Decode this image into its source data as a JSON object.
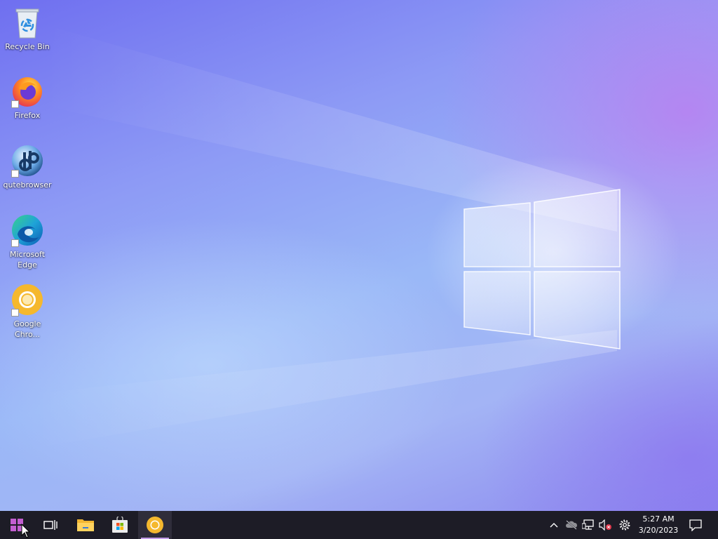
{
  "desktop": {
    "icons": [
      {
        "label": "Recycle Bin",
        "icon": "recycle-bin-icon"
      },
      {
        "label": "Firefox",
        "icon": "firefox-icon"
      },
      {
        "label": "qutebrowser",
        "icon": "qutebrowser-icon"
      },
      {
        "label": "Microsoft Edge",
        "icon": "edge-icon"
      },
      {
        "label": "Google Chro...",
        "icon": "chrome-icon"
      }
    ]
  },
  "taskbar": {
    "start_icon": "windows-start-icon",
    "task_view_icon": "task-view-icon",
    "pinned": [
      {
        "name": "File Explorer",
        "icon": "folder-icon"
      },
      {
        "name": "Microsoft Store",
        "icon": "store-icon"
      },
      {
        "name": "Google Chrome",
        "icon": "chrome-icon",
        "active": true
      }
    ],
    "tray": {
      "icons": [
        "chevron-up-icon",
        "onedrive-offline-icon",
        "network-icon",
        "volume-muted-icon",
        "settings-gear-icon"
      ],
      "time": "5:27 AM",
      "date": "3/20/2023",
      "notification_icon": "action-center-icon"
    }
  },
  "colors": {
    "taskbar_bg": "#1d1c26",
    "active_indicator": "#c39ce8"
  }
}
